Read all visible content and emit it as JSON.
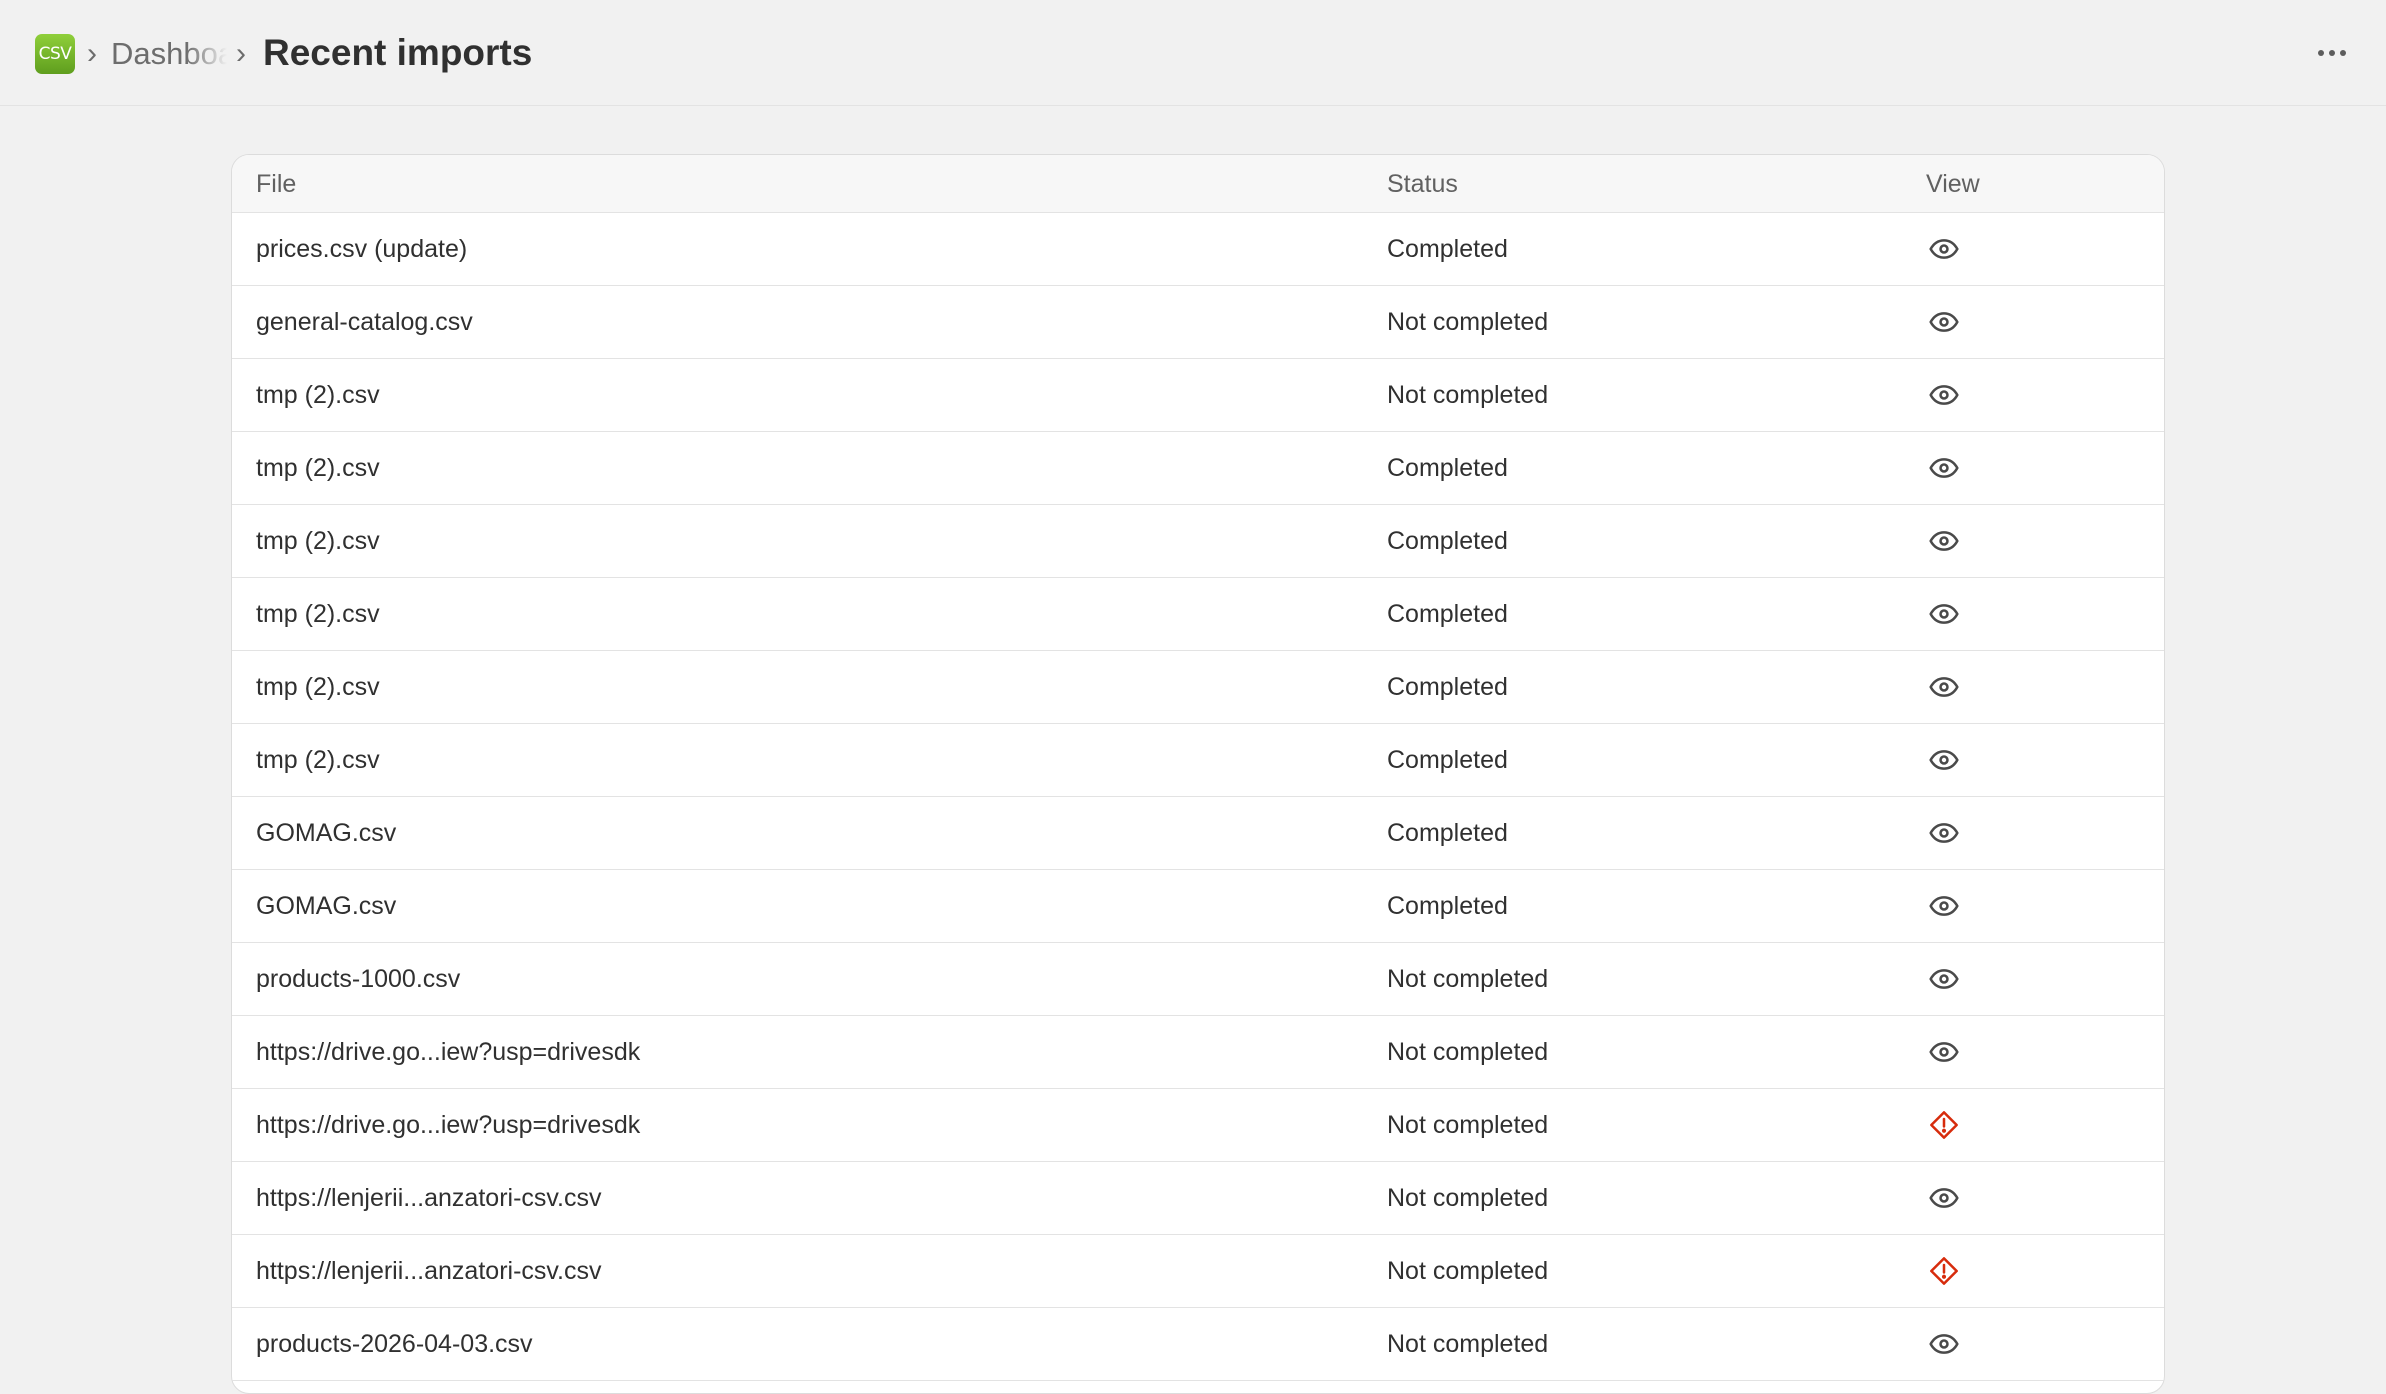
{
  "header": {
    "app_icon_text": "CSV",
    "breadcrumb_parent": "Dashboard",
    "title": "Recent imports",
    "more_icon": "more-horizontal-icon"
  },
  "table": {
    "columns": [
      "File",
      "Status",
      "View"
    ],
    "rows": [
      {
        "file": "prices.csv (update)",
        "status": "Completed",
        "icon": "eye-icon"
      },
      {
        "file": "general-catalog.csv",
        "status": "Not completed",
        "icon": "eye-icon"
      },
      {
        "file": "tmp (2).csv",
        "status": "Not completed",
        "icon": "eye-icon"
      },
      {
        "file": "tmp (2).csv",
        "status": "Completed",
        "icon": "eye-icon"
      },
      {
        "file": "tmp (2).csv",
        "status": "Completed",
        "icon": "eye-icon"
      },
      {
        "file": "tmp (2).csv",
        "status": "Completed",
        "icon": "eye-icon"
      },
      {
        "file": "tmp (2).csv",
        "status": "Completed",
        "icon": "eye-icon"
      },
      {
        "file": "tmp (2).csv",
        "status": "Completed",
        "icon": "eye-icon"
      },
      {
        "file": "GOMAG.csv",
        "status": "Completed",
        "icon": "eye-icon"
      },
      {
        "file": "GOMAG.csv",
        "status": "Completed",
        "icon": "eye-icon"
      },
      {
        "file": "products-1000.csv",
        "status": "Not completed",
        "icon": "eye-icon"
      },
      {
        "file": "https://drive.go...iew?usp=drivesdk",
        "status": "Not completed",
        "icon": "eye-icon"
      },
      {
        "file": "https://drive.go...iew?usp=drivesdk",
        "status": "Not completed",
        "icon": "alert-diamond-icon"
      },
      {
        "file": "https://lenjerii...anzatori-csv.csv",
        "status": "Not completed",
        "icon": "eye-icon"
      },
      {
        "file": "https://lenjerii...anzatori-csv.csv",
        "status": "Not completed",
        "icon": "alert-diamond-icon"
      },
      {
        "file": "products-2026-04-03.csv",
        "status": "Not completed",
        "icon": "eye-icon"
      }
    ]
  },
  "colors": {
    "background": "#f1f1f1",
    "card": "#ffffff",
    "text": "#303030",
    "muted": "#616161",
    "icon": "#4a4a4a",
    "alert": "#d72c0d",
    "app_icon": "#6fb229"
  }
}
